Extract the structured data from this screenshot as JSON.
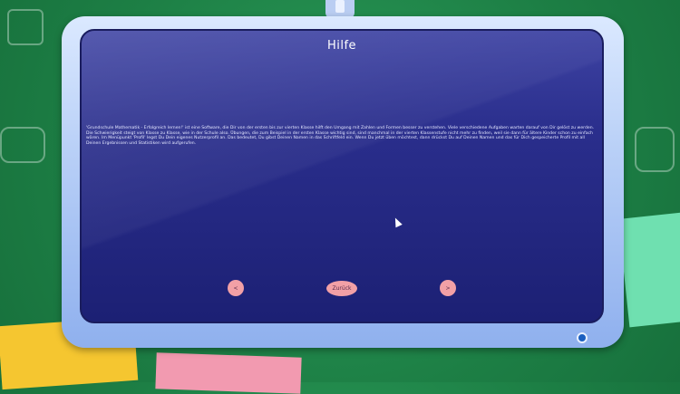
{
  "header": {
    "title": "Hilfe"
  },
  "content": {
    "text": "'Grundschule Mathematik - Erfolgreich lernen!' ist eine Software, die Dir von der ersten bis zur vierten Klasse hilft den Umgang mit Zahlen und Formen besser zu verstehen. Viele verschiedene Aufgaben warten darauf von Dir gelöst zu werden. Die Schwierigkeit steigt von Klasse zu Klasse, wie in der Schule also. Übungen, die zum Beispiel in der ersten Klasse wichtig sind, sind manchmal in der vierten Klassenstufe nicht mehr zu finden, weil sie dann für ältere Kinder schon zu einfach wären. Im Menüpunkt 'Profil' legst Du Dein eigenes Nutzerprofil an. Das bedeutet, Du gibst Deinen Namen in das Schriftfeld ein. Wenn Du jetzt üben möchtest, dann drückst Du auf Deinen Namen und das für Dich gespeicherte Profil mit all Deinen Ergebnissen und Statistiken wird aufgerufen."
  },
  "nav": {
    "prev_label": "<",
    "back_label": "Zurück",
    "next_label": ">"
  },
  "colors": {
    "button": "#f2a0a6",
    "screen": "#2a2e8c",
    "background": "#1d7f45"
  }
}
